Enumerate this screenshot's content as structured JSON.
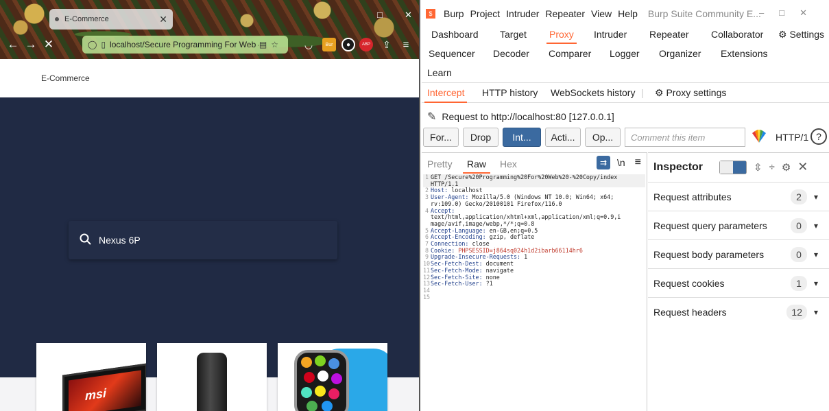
{
  "firefox": {
    "tab_title": "E-Commerce",
    "url": "localhost/Secure Programming For Web -",
    "extensions": [
      "Bur",
      "ABP"
    ],
    "site": {
      "brand": "E-Commerce",
      "search_value": "Nexus 6P",
      "product_logo": "msi"
    }
  },
  "burp": {
    "menu": [
      "Burp",
      "Project",
      "Intruder",
      "Repeater",
      "View",
      "Help"
    ],
    "window_title": "Burp Suite Community E...",
    "top_tabs_row1": [
      "Dashboard",
      "Target",
      "Proxy",
      "Intruder",
      "Repeater",
      "Collaborator",
      "Settings"
    ],
    "top_tabs_row2": [
      "Sequencer",
      "Decoder",
      "Comparer",
      "Logger",
      "Organizer",
      "Extensions"
    ],
    "top_tabs_row3": [
      "Learn"
    ],
    "active_top_tab": "Proxy",
    "proxy_tabs": [
      "Intercept",
      "HTTP history",
      "WebSockets history",
      "Proxy settings"
    ],
    "request_to": "Request to http://localhost:80  [127.0.0.1]",
    "buttons": {
      "forward": "For...",
      "drop": "Drop",
      "intercept": "Int...",
      "action": "Acti...",
      "open": "Op..."
    },
    "comment_placeholder": "Comment this item",
    "http_version": "HTTP/1",
    "editor_tabs": [
      "Pretty",
      "Raw",
      "Hex"
    ],
    "editor_newline_toggle": "\\n",
    "request_lines": [
      {
        "n": "1",
        "key": "",
        "val": "GET /Secure%20Programming%20For%20Web%20-%20Copy/index",
        "cont": "HTTP/1.1"
      },
      {
        "n": "2",
        "key": "Host:",
        "val": " localhost"
      },
      {
        "n": "3",
        "key": "User-Agent:",
        "val": " Mozilla/5.0 (Windows NT 10.0; Win64; x64;",
        "cont": "rv:109.0) Gecko/20100101 Firefox/116.0"
      },
      {
        "n": "4",
        "key": "Accept:",
        "val": "",
        "cont": "text/html,application/xhtml+xml,application/xml;q=0.9,i",
        "cont2": "mage/avif,image/webp,*/*;q=0.8"
      },
      {
        "n": "5",
        "key": "Accept-Language:",
        "val": " en-GB,en;q=0.5"
      },
      {
        "n": "6",
        "key": "Accept-Encoding:",
        "val": " gzip, deflate"
      },
      {
        "n": "7",
        "key": "Connection:",
        "val": " close"
      },
      {
        "n": "8",
        "key": "Cookie:",
        "val": " PHPSESSID=j864sq024h1d2ibarb66114hr6"
      },
      {
        "n": "9",
        "key": "Upgrade-Insecure-Requests:",
        "val": " 1"
      },
      {
        "n": "10",
        "key": "Sec-Fetch-Dest:",
        "val": " document"
      },
      {
        "n": "11",
        "key": "Sec-Fetch-Mode:",
        "val": " navigate"
      },
      {
        "n": "12",
        "key": "Sec-Fetch-Site:",
        "val": " none"
      },
      {
        "n": "13",
        "key": "Sec-Fetch-User:",
        "val": " ?1"
      },
      {
        "n": "14",
        "key": "",
        "val": ""
      },
      {
        "n": "15",
        "key": "",
        "val": ""
      }
    ],
    "inspector": {
      "title": "Inspector",
      "rows": [
        {
          "label": "Request attributes",
          "count": "2"
        },
        {
          "label": "Request query parameters",
          "count": "0"
        },
        {
          "label": "Request body parameters",
          "count": "0"
        },
        {
          "label": "Request cookies",
          "count": "1"
        },
        {
          "label": "Request headers",
          "count": "12"
        }
      ]
    },
    "colors": {
      "accent": "#ff6633",
      "primary": "#3b6aa0"
    }
  }
}
